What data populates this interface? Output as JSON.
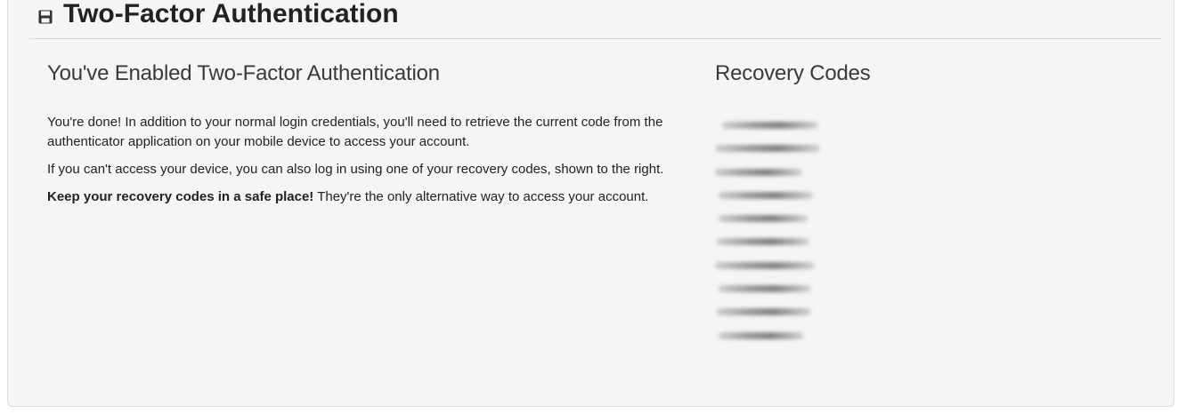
{
  "panel": {
    "title": "Two-Factor Authentication",
    "icon": "floppy-disk-icon"
  },
  "left": {
    "heading": "You've Enabled Two-Factor Authentication",
    "paragraph1": "You're done! In addition to your normal login credentials, you'll need to retrieve the current code from the authenticator application on your mobile device to access your account.",
    "paragraph2": "If you can't access your device, you can also log in using one of your recovery codes, shown to the right.",
    "paragraph3_bold": "Keep your recovery codes in a safe place!",
    "paragraph3_rest": " They're the only alternative way to access your account."
  },
  "right": {
    "heading": "Recovery Codes",
    "codes_note": "10 recovery codes, blurred/obscured in the screenshot"
  },
  "colors": {
    "panel_bg": "#f5f5f5",
    "border": "#dcdcdc",
    "text": "#222222"
  }
}
